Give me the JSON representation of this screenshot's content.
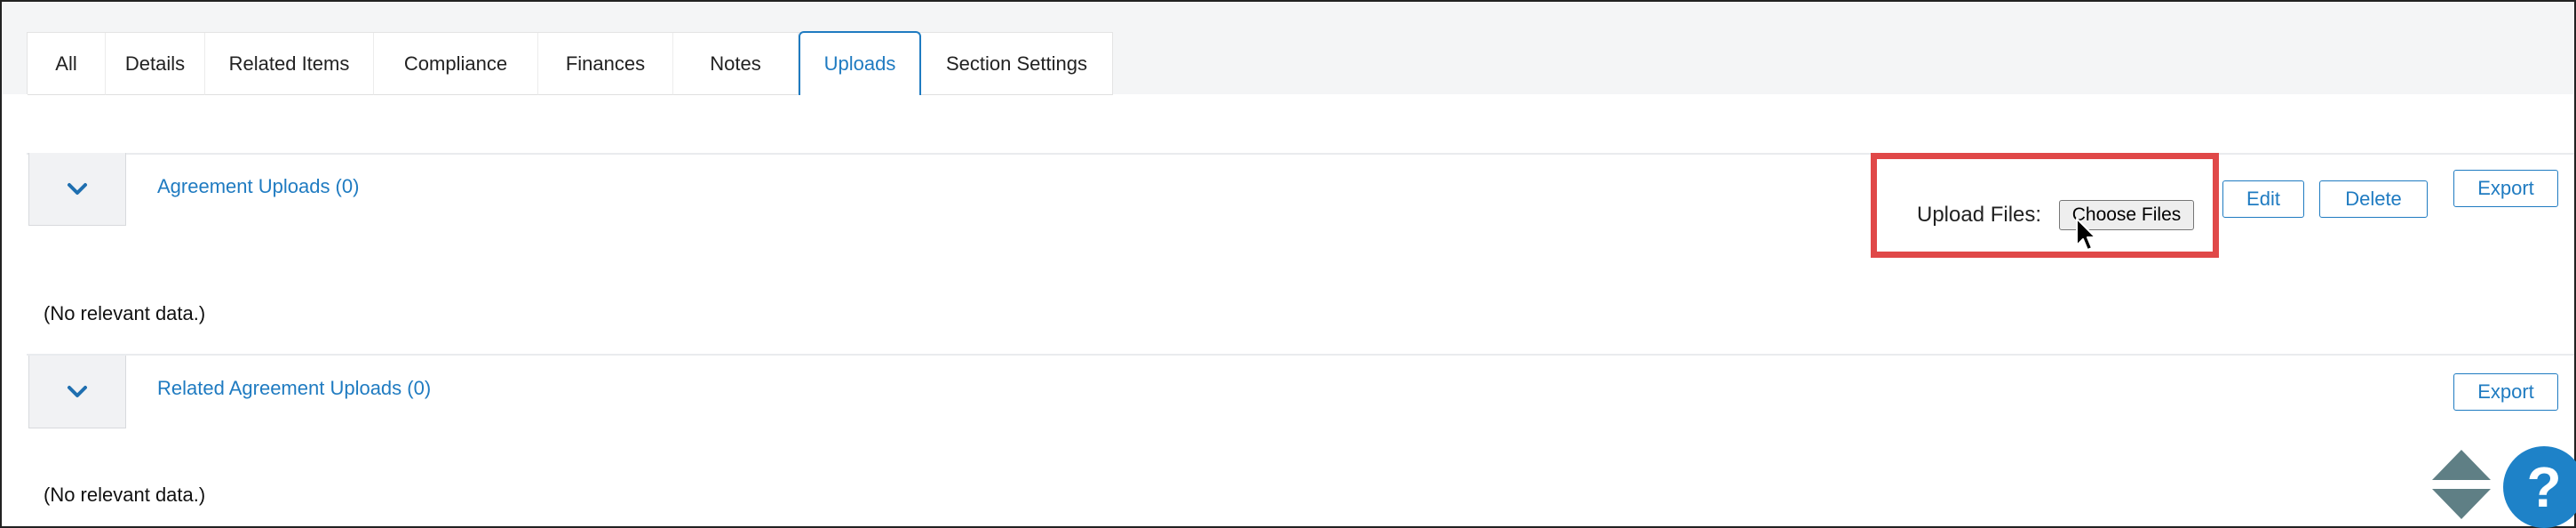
{
  "tabs": [
    {
      "label": "All"
    },
    {
      "label": "Details"
    },
    {
      "label": "Related Items"
    },
    {
      "label": "Compliance"
    },
    {
      "label": "Finances"
    },
    {
      "label": "Notes"
    },
    {
      "label": "Uploads",
      "active": true
    },
    {
      "label": "Section Settings"
    }
  ],
  "sections": {
    "agreement_uploads": {
      "title": "Agreement Uploads (0)",
      "empty_text": "(No relevant data.)",
      "upload_label": "Upload Files:",
      "choose_files_label": "Choose Files",
      "edit_label": "Edit",
      "delete_label": "Delete",
      "export_label": "Export"
    },
    "related_agreement_uploads": {
      "title": "Related Agreement Uploads (0)",
      "empty_text": "(No relevant data.)",
      "export_label": "Export"
    }
  },
  "help": {
    "symbol": "?"
  },
  "colors": {
    "accent": "#1f7bc1",
    "highlight": "#e04848",
    "help_bg": "#1e82c8",
    "scroll_arrows": "#5f7f85"
  },
  "icons": [
    "chevron-down-icon",
    "mouse-cursor-icon",
    "scroll-up-icon",
    "scroll-down-icon",
    "help-icon"
  ]
}
